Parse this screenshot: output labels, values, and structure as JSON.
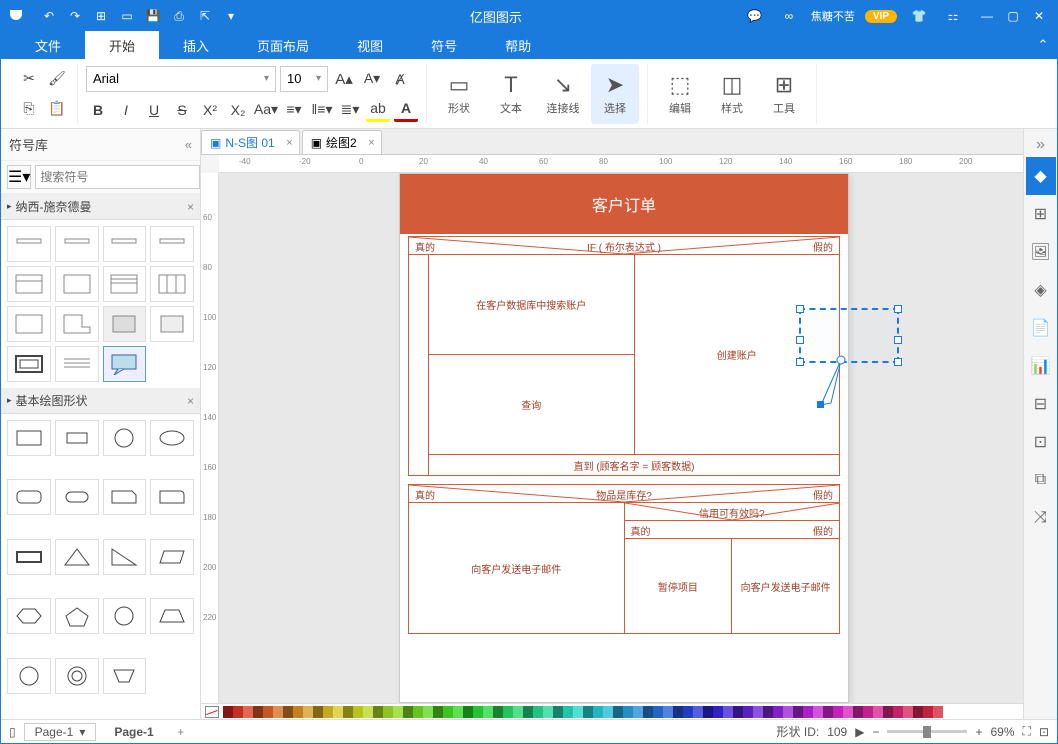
{
  "app": {
    "title": "亿图图示",
    "user": "焦糖不苦",
    "vip": "VIP"
  },
  "menu": {
    "file": "文件",
    "home": "开始",
    "insert": "插入",
    "layout": "页面布局",
    "view": "视图",
    "symbol": "符号",
    "help": "帮助"
  },
  "ribbon": {
    "font": "Arial",
    "size": "10",
    "shape": "形状",
    "text": "文本",
    "connector": "连接线",
    "select": "选择",
    "edit": "编辑",
    "style": "样式",
    "tools": "工具"
  },
  "shapes": {
    "title": "符号库",
    "search_ph": "搜索符号",
    "cat1": "纳西-施奈德曼",
    "cat2": "基本绘图形状"
  },
  "tabs": {
    "t1": "N-S图 01",
    "t2": "绘图2"
  },
  "diagram": {
    "title": "客户订单",
    "if": "IF ( 布尔表达式 )",
    "true": "真的",
    "false": "假的",
    "b1": "在客户数据库中搜索账户",
    "b2": "创建账户",
    "b3": "查询",
    "b4": "直到 (顾客名字 = 顾客数据)",
    "q1": "物品是库存?",
    "q2": "信用可有效吗?",
    "b5": "向客户发送电子邮件",
    "b6": "暂停项目",
    "b7": "向客户发送电子邮件"
  },
  "status": {
    "page_sel": "Page-1",
    "page": "Page-1",
    "shape_id": "形状 ID:",
    "shape_n": "109",
    "zoom": "69%"
  }
}
